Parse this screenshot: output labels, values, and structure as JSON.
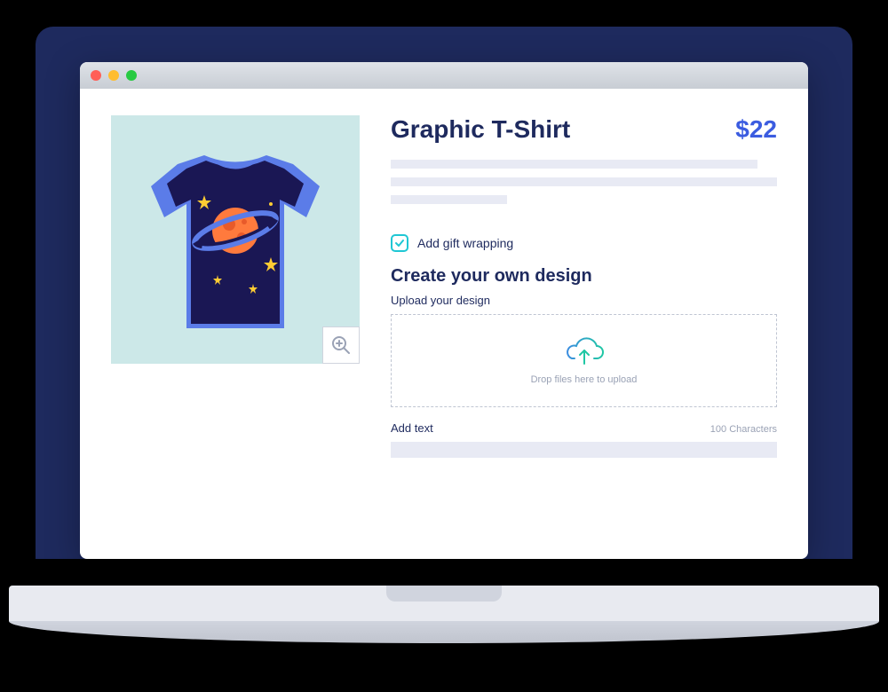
{
  "product": {
    "title": "Graphic T-Shirt",
    "price": "$22",
    "gift_wrap_label": "Add gift wrapping",
    "gift_wrap_checked": true
  },
  "design": {
    "heading": "Create your own design",
    "upload_label": "Upload your design",
    "dropzone_text": "Drop files here to upload",
    "add_text_label": "Add text",
    "char_limit": "100 Characters"
  },
  "colors": {
    "navy": "#1e2a5e",
    "blue_accent": "#3b5ce0",
    "teal": "#1fc7d4",
    "placeholder": "#e8eaf4",
    "image_bg": "#cce8e8"
  }
}
